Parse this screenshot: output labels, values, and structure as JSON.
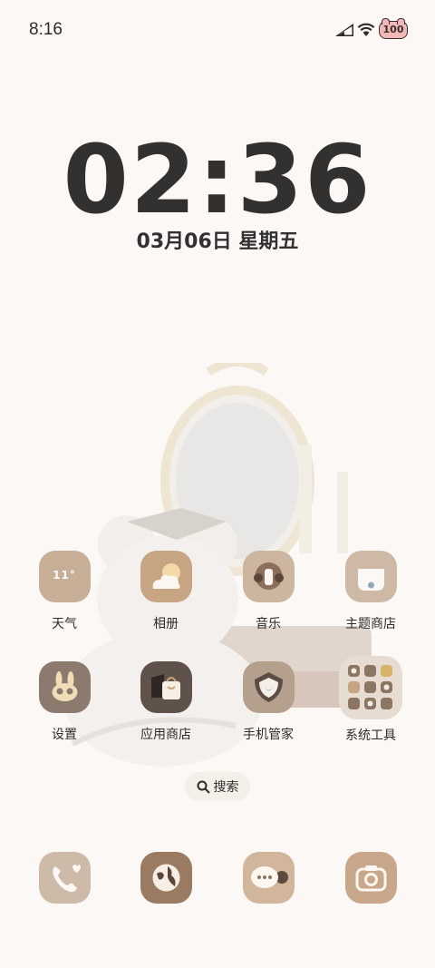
{
  "status_bar": {
    "time": "8:16",
    "battery": "100"
  },
  "lockclock": {
    "time": "02:36",
    "date": "03月06日 星期五"
  },
  "apps": [
    {
      "label": "天气",
      "icon": "weather-icon",
      "icon_text": "11°"
    },
    {
      "label": "相册",
      "icon": "gallery-cloud-icon"
    },
    {
      "label": "音乐",
      "icon": "music-icon"
    },
    {
      "label": "主题商店",
      "icon": "theme-store-icon"
    },
    {
      "label": "设置",
      "icon": "settings-bunny-icon"
    },
    {
      "label": "应用商店",
      "icon": "app-store-bag-icon"
    },
    {
      "label": "手机管家",
      "icon": "phone-manager-shield-icon"
    },
    {
      "label": "系统工具",
      "icon": "system-tools-folder-icon"
    }
  ],
  "search": {
    "label": "搜索"
  },
  "dock": [
    {
      "icon": "phone-icon"
    },
    {
      "icon": "browser-globe-icon"
    },
    {
      "icon": "messages-icon"
    },
    {
      "icon": "camera-icon"
    }
  ],
  "colors": {
    "background": "#fbf8f5",
    "icon_tan": "#c9b29a",
    "icon_brown": "#8a7563",
    "icon_dark": "#5b4a40"
  }
}
